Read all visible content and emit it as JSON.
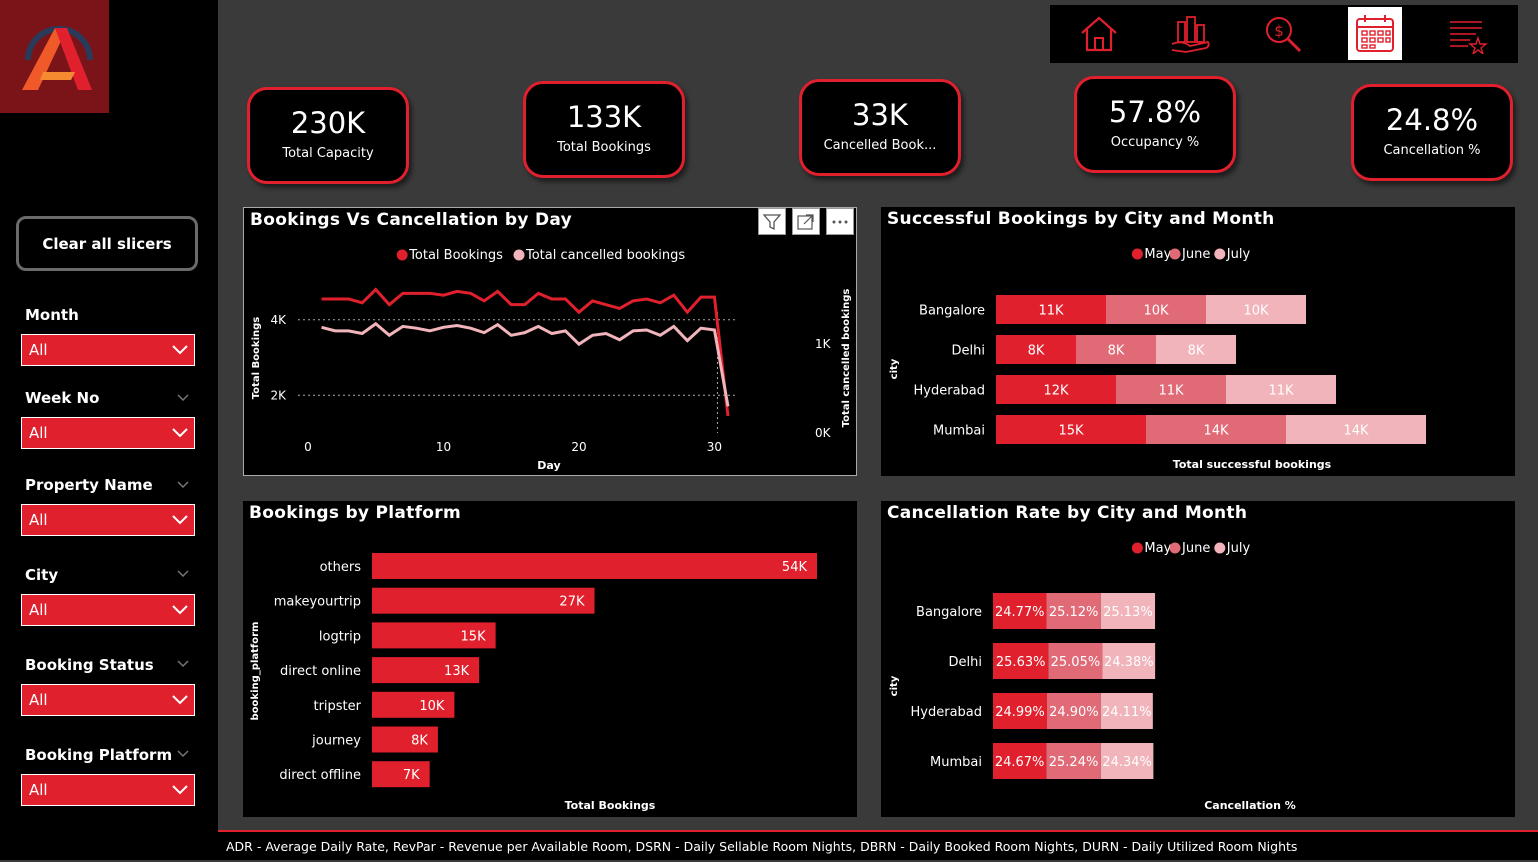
{
  "nav": {
    "items": [
      {
        "name": "home-icon",
        "active": false
      },
      {
        "name": "city-hand-icon",
        "active": false
      },
      {
        "name": "revenue-search-icon",
        "active": false
      },
      {
        "name": "calendar-icon",
        "active": true
      },
      {
        "name": "list-star-icon",
        "active": false
      }
    ]
  },
  "sidebar": {
    "clear_label": "Clear all slicers",
    "slicers": [
      {
        "title": "Month",
        "value": "All"
      },
      {
        "title": "Week No",
        "value": "All"
      },
      {
        "title": "Property Name",
        "value": "All"
      },
      {
        "title": "City",
        "value": "All"
      },
      {
        "title": "Booking Status",
        "value": "All"
      },
      {
        "title": "Booking Platform",
        "value": "All"
      }
    ]
  },
  "kpis": [
    {
      "value": "230K",
      "label": "Total Capacity"
    },
    {
      "value": "133K",
      "label": "Total Bookings"
    },
    {
      "value": "33K",
      "label": "Cancelled Book..."
    },
    {
      "value": "57.8%",
      "label": "Occupancy %"
    },
    {
      "value": "24.8%",
      "label": "Cancellation %"
    }
  ],
  "colors": {
    "accent": "#e0202d",
    "may": "#e0202d",
    "june": "#e16a77",
    "july": "#f0b4ba",
    "mid_red": "#d63444"
  },
  "footer": "ADR - Average Daily Rate, RevPar - Revenue per Available Room, DSRN - Daily Sellable Room Nights, DBRN - Daily Booked Room Nights, DURN - Daily Utilized Room Nights",
  "chart_data": [
    {
      "type": "line",
      "title": "Bookings Vs Cancellation by Day",
      "xlabel": "Day",
      "ylabel": "Total Bookings",
      "y2label": "Total cancelled bookings",
      "xticks": [
        "0",
        "10",
        "20",
        "30"
      ],
      "yticks": [
        "2K",
        "4K"
      ],
      "y2ticks": [
        "0K",
        "1K"
      ],
      "xlim": [
        0,
        31
      ],
      "ylim": [
        1000,
        5000
      ],
      "y2lim": [
        0,
        1700
      ],
      "series": [
        {
          "name": "Total Bookings",
          "axis": "left",
          "x": [
            1,
            2,
            3,
            4,
            5,
            6,
            7,
            8,
            9,
            10,
            11,
            12,
            13,
            14,
            15,
            16,
            17,
            18,
            19,
            20,
            21,
            22,
            23,
            24,
            25,
            26,
            27,
            28,
            29,
            30,
            31
          ],
          "values": [
            4550,
            4550,
            4550,
            4450,
            4800,
            4400,
            4700,
            4700,
            4700,
            4650,
            4750,
            4700,
            4500,
            4750,
            4400,
            4400,
            4700,
            4550,
            4550,
            4200,
            4500,
            4400,
            4300,
            4500,
            4550,
            4450,
            4650,
            4200,
            4600,
            4600,
            1450
          ]
        },
        {
          "name": "Total cancelled bookings",
          "axis": "right",
          "x": [
            1,
            2,
            3,
            4,
            5,
            6,
            7,
            8,
            9,
            10,
            11,
            12,
            13,
            14,
            15,
            16,
            17,
            18,
            19,
            20,
            21,
            22,
            23,
            24,
            25,
            26,
            27,
            28,
            29,
            30,
            31
          ],
          "values": [
            1190,
            1150,
            1150,
            1120,
            1230,
            1100,
            1200,
            1180,
            1150,
            1190,
            1210,
            1180,
            1130,
            1220,
            1100,
            1130,
            1200,
            1120,
            1150,
            1000,
            1100,
            1120,
            1050,
            1150,
            1160,
            1100,
            1200,
            1040,
            1180,
            1160,
            300
          ]
        }
      ],
      "legend": "top-center"
    },
    {
      "type": "bar",
      "orientation": "horizontal",
      "stacked": true,
      "title": "Successful Bookings by City and Month",
      "xlabel": "Total successful bookings",
      "ylabel": "city",
      "categories": [
        "Bangalore",
        "Delhi",
        "Hyderabad",
        "Mumbai"
      ],
      "series": [
        {
          "name": "May",
          "values": [
            11000,
            8000,
            12000,
            15000
          ],
          "labels": [
            "11K",
            "8K",
            "12K",
            "15K"
          ]
        },
        {
          "name": "June",
          "values": [
            10000,
            8000,
            11000,
            14000
          ],
          "labels": [
            "10K",
            "8K",
            "11K",
            "14K"
          ]
        },
        {
          "name": "July",
          "values": [
            10000,
            8000,
            11000,
            14000
          ],
          "labels": [
            "10K",
            "8K",
            "11K",
            "14K"
          ]
        }
      ],
      "legend": "top-center"
    },
    {
      "type": "bar",
      "orientation": "horizontal",
      "title": "Bookings by Platform",
      "xlabel": "Total Bookings",
      "ylabel": "booking_platform",
      "categories": [
        "others",
        "makeyourtrip",
        "logtrip",
        "direct online",
        "tripster",
        "journey",
        "direct offline"
      ],
      "values": [
        54000,
        27000,
        15000,
        13000,
        10000,
        8000,
        7000
      ],
      "labels": [
        "54K",
        "27K",
        "15K",
        "13K",
        "10K",
        "8K",
        "7K"
      ]
    },
    {
      "type": "bar",
      "orientation": "horizontal",
      "stacked": true,
      "title": "Cancellation Rate by City and Month",
      "xlabel": "Cancellation %",
      "ylabel": "city",
      "categories": [
        "Bangalore",
        "Delhi",
        "Hyderabad",
        "Mumbai"
      ],
      "series": [
        {
          "name": "May",
          "values": [
            24.77,
            25.63,
            24.99,
            24.67
          ],
          "labels": [
            "24.77%",
            "25.63%",
            "24.99%",
            "24.67%"
          ]
        },
        {
          "name": "June",
          "values": [
            25.12,
            25.05,
            24.9,
            25.24
          ],
          "labels": [
            "25.12%",
            "25.05%",
            "24.90%",
            "25.24%"
          ]
        },
        {
          "name": "July",
          "values": [
            25.13,
            24.38,
            24.11,
            24.34
          ],
          "labels": [
            "25.13%",
            "24.38%",
            "24.11%",
            "24.34%"
          ]
        }
      ],
      "legend": "top-center"
    }
  ]
}
